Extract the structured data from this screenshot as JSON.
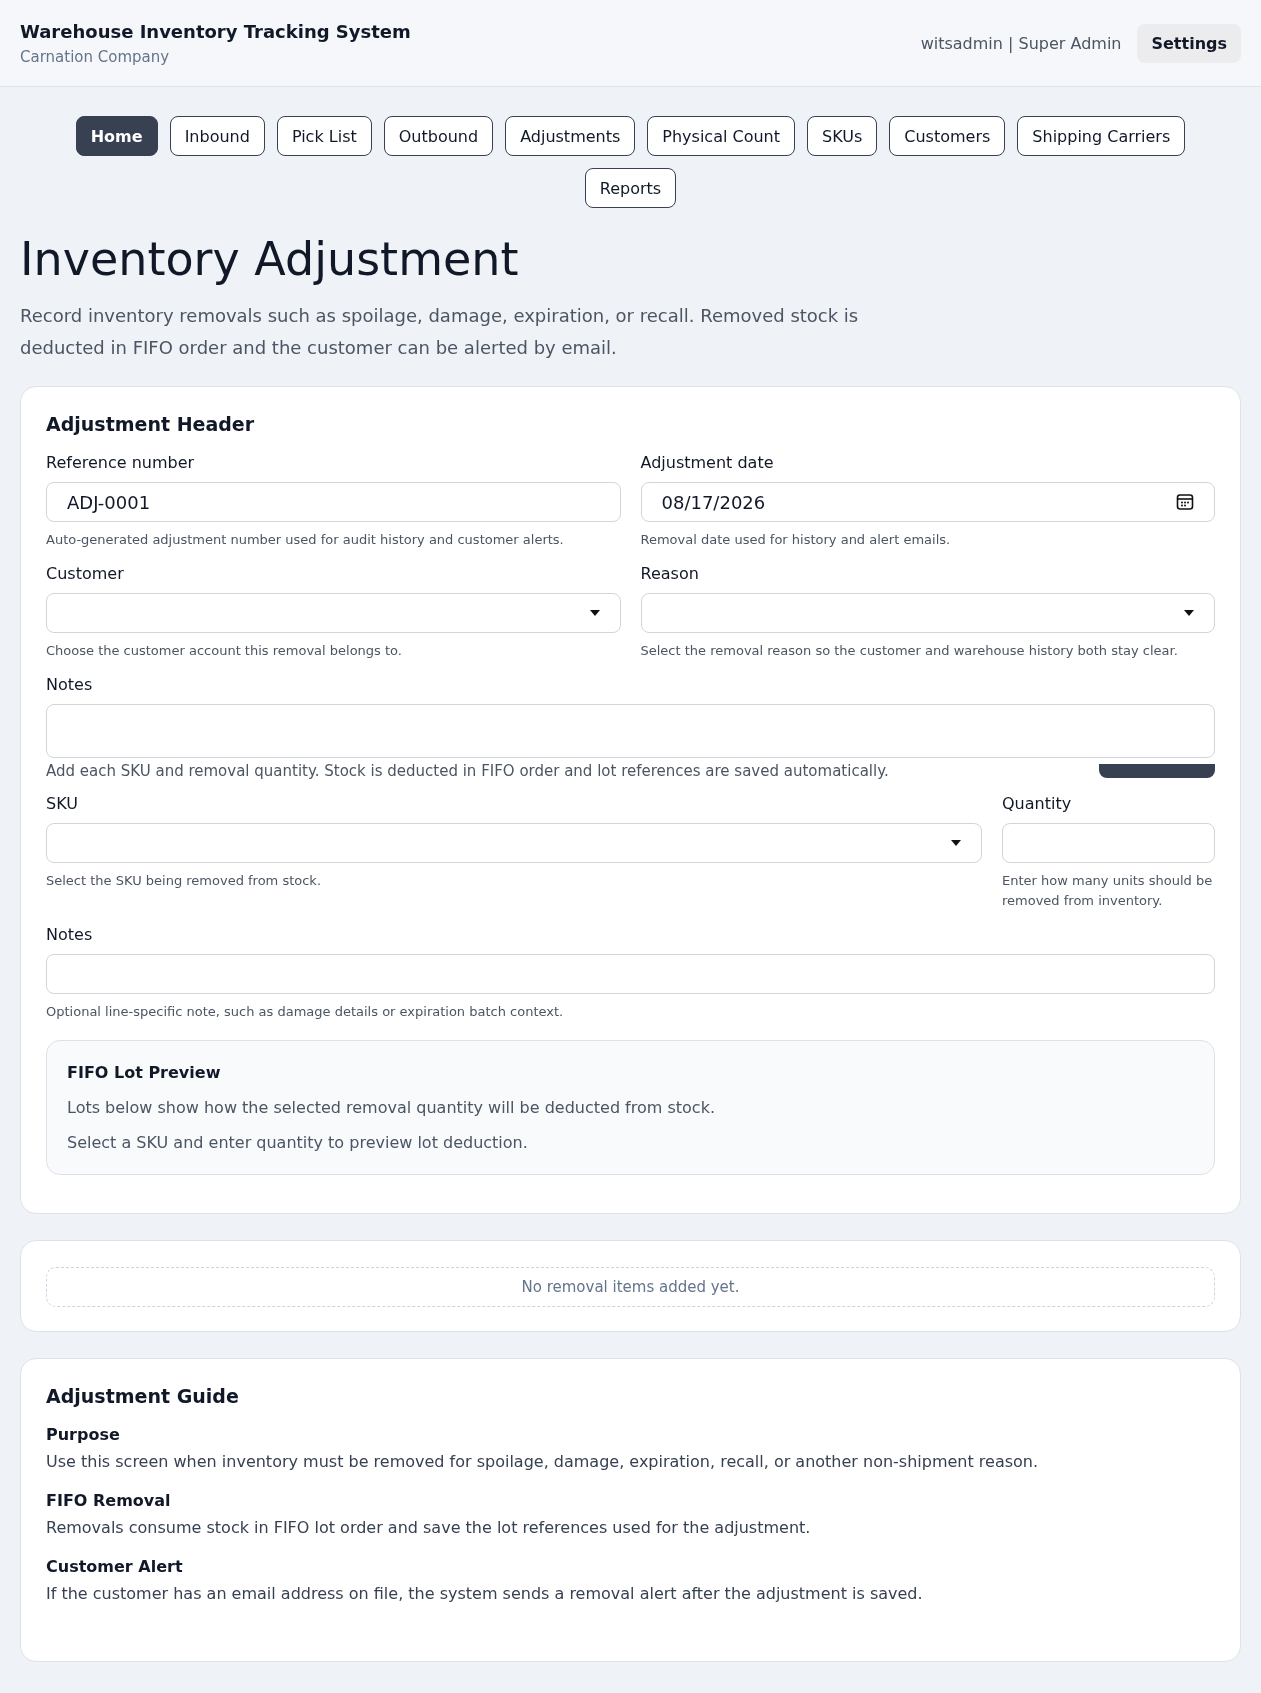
{
  "header": {
    "title": "Warehouse Inventory Tracking System",
    "subtitle": "Carnation Company",
    "user": "witsadmin | Super Admin",
    "settings_button": "Settings"
  },
  "nav": [
    {
      "label": "Home",
      "selected": true
    },
    {
      "label": "Inbound",
      "selected": false
    },
    {
      "label": "Pick List",
      "selected": false
    },
    {
      "label": "Outbound",
      "selected": false
    },
    {
      "label": "Adjustments",
      "selected": false
    },
    {
      "label": "Physical Count",
      "selected": false
    },
    {
      "label": "SKUs",
      "selected": false
    },
    {
      "label": "Customers",
      "selected": false
    },
    {
      "label": "Shipping Carriers",
      "selected": false
    },
    {
      "label": "Reports",
      "selected": false
    }
  ],
  "page": {
    "title": "Inventory Adjustment",
    "description": "Record inventory removals such as spoilage, damage, expiration, or recall. Removed stock is deducted in FIFO order and the customer can be alerted by email."
  },
  "adjustment_header": {
    "title": "Adjustment Header",
    "reference": {
      "label": "Reference number",
      "value": "ADJ-0001",
      "help": "Auto-generated adjustment number used for audit history and customer alerts."
    },
    "date": {
      "label": "Adjustment date",
      "value": "08/17/2026",
      "help": "Removal date used for history and alert emails."
    },
    "customer": {
      "label": "Customer",
      "help": "Choose the customer account this removal belongs to."
    },
    "reason": {
      "label": "Reason",
      "help": "Select the removal reason so the customer and warehouse history both stay clear."
    },
    "notes": {
      "label": "Notes"
    },
    "lines_intro": "Add each SKU and removal quantity. Stock is deducted in FIFO order and lot references are saved automatically.",
    "sku": {
      "label": "SKU",
      "help": "Select the SKU being removed from stock."
    },
    "quantity": {
      "label": "Quantity",
      "help": "Enter how many units should be removed from inventory."
    },
    "line_notes": {
      "label": "Notes",
      "help": "Optional line-specific note, such as damage details or expiration batch context."
    },
    "fifo": {
      "title": "FIFO Lot Preview",
      "description": "Lots below show how the selected removal quantity will be deducted from stock.",
      "empty": "Select a SKU and enter quantity to preview lot deduction."
    }
  },
  "removal_summary": {
    "empty": "No removal items added yet."
  },
  "guide": {
    "title": "Adjustment Guide",
    "sections": [
      {
        "title": "Purpose",
        "text": "Use this screen when inventory must be removed for spoilage, damage, expiration, recall, or another non-shipment reason."
      },
      {
        "title": "FIFO Removal",
        "text": "Removals consume stock in FIFO lot order and save the lot references used for the adjustment."
      },
      {
        "title": "Customer Alert",
        "text": "If the customer has an email address on file, the system sends a removal alert after the adjustment is saved."
      }
    ]
  }
}
